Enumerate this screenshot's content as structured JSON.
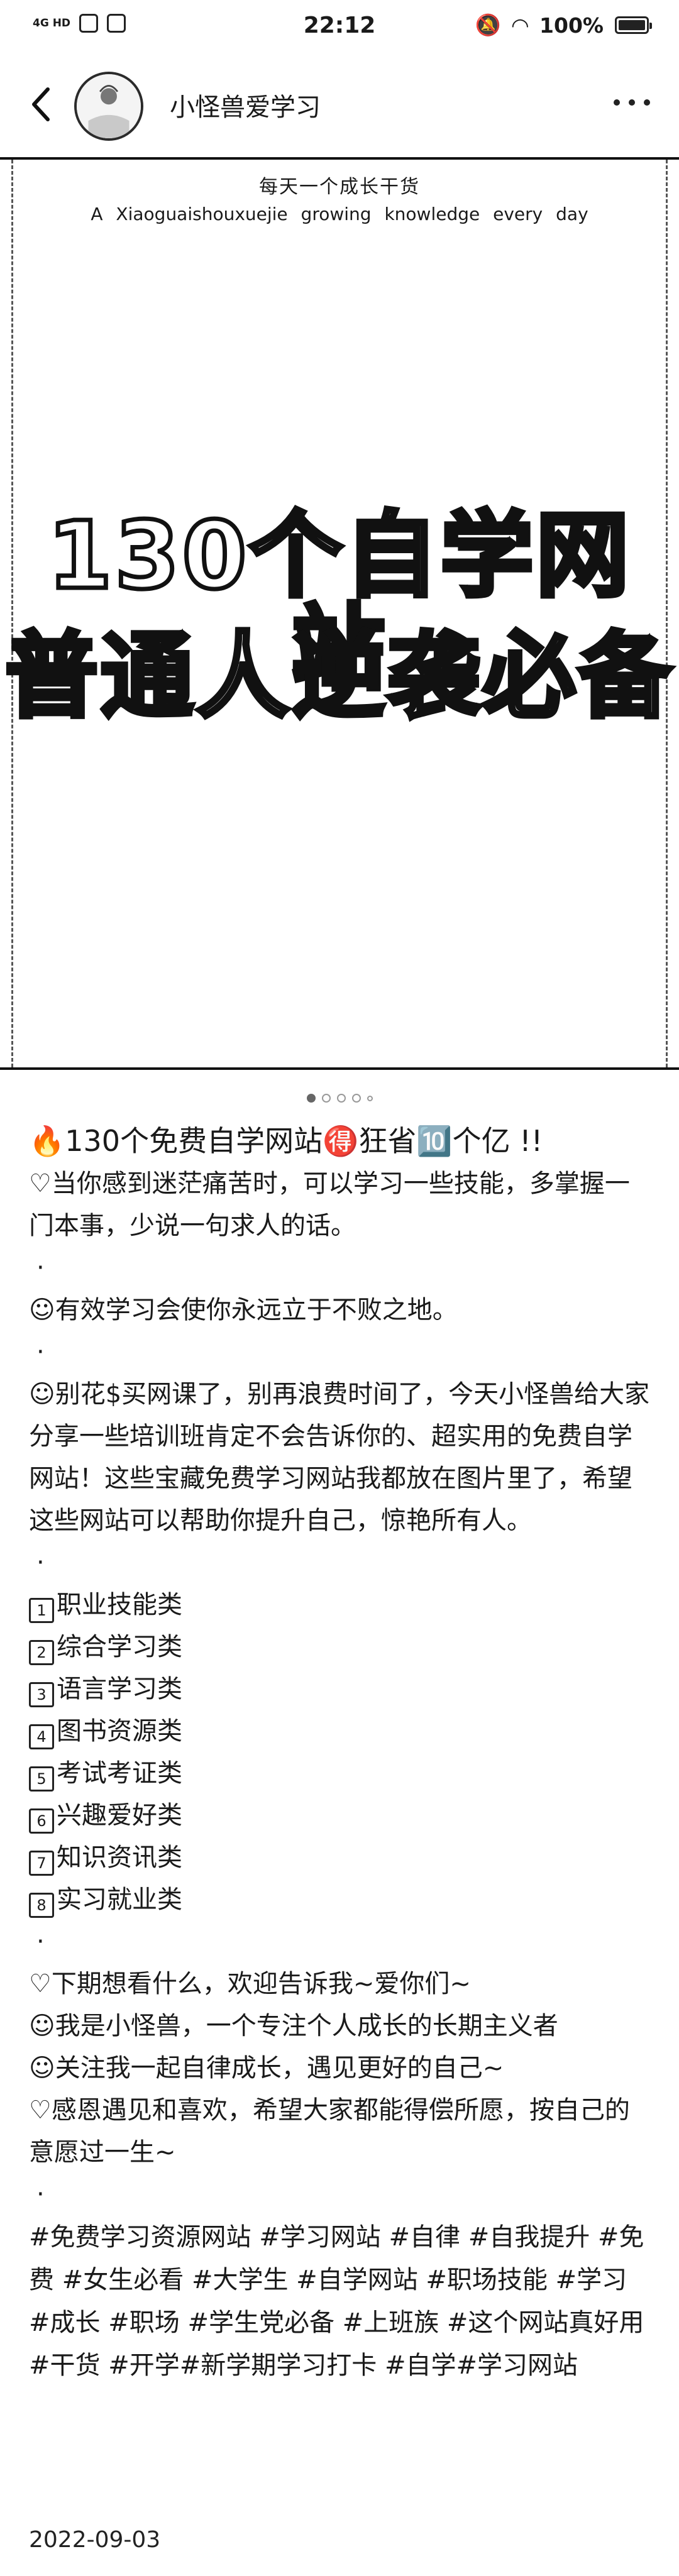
{
  "status_bar": {
    "network": "4G HD",
    "time": "22:12",
    "battery": "100%"
  },
  "header": {
    "author": "小怪兽爱学习"
  },
  "post_image": {
    "subtitle_cn": "每天一个成长干货",
    "subtitle_en": "A Xiaoguaishouxuejie growing knowledge every day",
    "headline_1": "130个自学网站",
    "headline_2": "普通人逆袭必备"
  },
  "carousel": {
    "total": 5,
    "active_index": 0
  },
  "post": {
    "title": "🔥130个免费自学网站🉐狂省🔟个亿 !!",
    "para1": "♡当你感到迷茫痛苦时，可以学习一些技能，多掌握一门本事，少说一句求人的话。",
    "dot": "·",
    "para2": "☺有效学习会使你永远立于不败之地。",
    "para3": "☺别花$买网课了，别再浪费时间了，今天小怪兽给大家分享一些培训班肯定不会告诉你的、超实用的免费自学网站！这些宝藏免费学习网站我都放在图片里了，希望这些网站可以帮助你提升自己，惊艳所有人。",
    "categories": [
      {
        "num": "1",
        "label": "职业技能类"
      },
      {
        "num": "2",
        "label": "综合学习类"
      },
      {
        "num": "3",
        "label": "语言学习类"
      },
      {
        "num": "4",
        "label": "图书资源类"
      },
      {
        "num": "5",
        "label": "考试考证类"
      },
      {
        "num": "6",
        "label": "兴趣爱好类"
      },
      {
        "num": "7",
        "label": "知识资讯类"
      },
      {
        "num": "8",
        "label": "实习就业类"
      }
    ],
    "closing": [
      "♡下期想看什么，欢迎告诉我~爱你们~",
      "☺我是小怪兽，一个专注个人成长的长期主义者",
      "☺关注我一起自律成长，遇见更好的自己~",
      "♡感恩遇见和喜欢，希望大家都能得偿所愿，按自己的意愿过一生~"
    ],
    "hashtags": "#免费学习资源网站 #学习网站 #自律 #自我提升 #免费 #女生必看 #大学生 #自学网站 #职场技能 #学习 #成长 #职场 #学生党必备 #上班族 #这个网站真好用 #干货 #开学#新学期学习打卡 #自学#学习网站",
    "date": "2022-09-03"
  }
}
